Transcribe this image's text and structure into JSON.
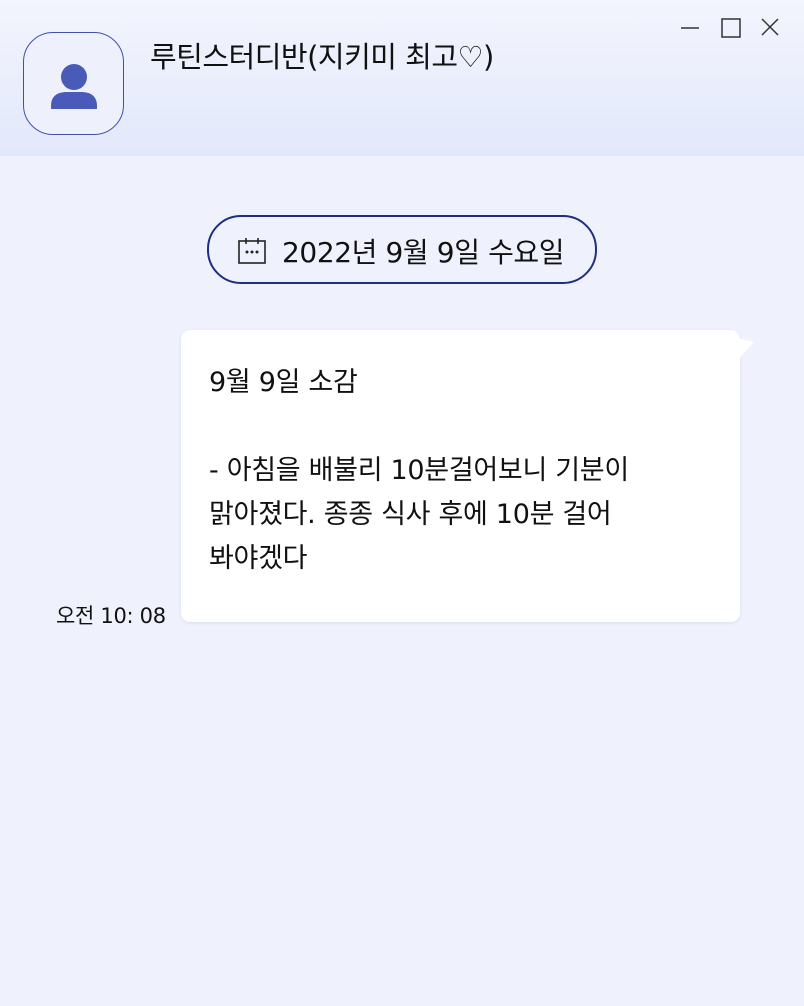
{
  "window": {
    "title": "루틴스터디반(지키미 최고♡)",
    "controls": [
      "minimize-icon",
      "maximize-icon",
      "close-icon"
    ]
  },
  "header": {
    "avatar_icon": "person-icon",
    "accent_color": "#4a5ab8"
  },
  "date_divider": {
    "icon": "calendar-icon",
    "label": "2022년 9월 9일 수요일",
    "border_color": "#1f2d83"
  },
  "message": {
    "lines": [
      "9월 9일 소감",
      "",
      "- 아침을 배불리 10분걸어보니 기분이",
      "맑아졌다. 종종 식사 후에 10분 걸어",
      "봐야겠다"
    ],
    "time": "오전 10: 08",
    "bubble_color": "#ffffff"
  },
  "colors": {
    "background": "#eff2fd",
    "header_top": "#f3f5fd",
    "header_bottom": "#e2e8fb"
  }
}
